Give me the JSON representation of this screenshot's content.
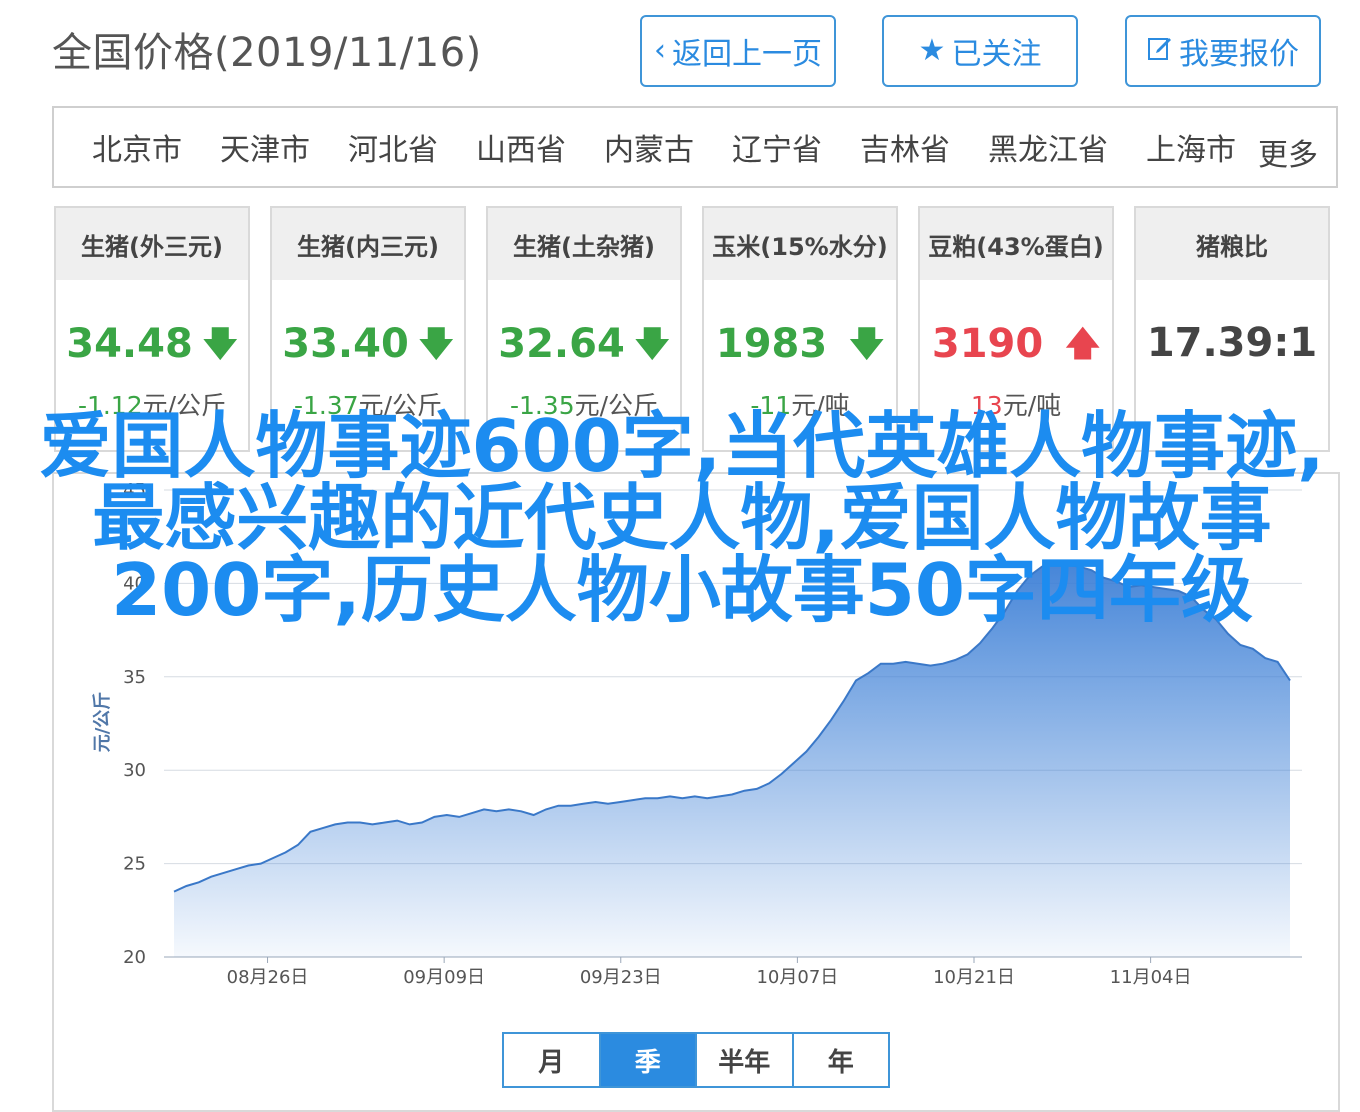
{
  "header": {
    "title": "全国价格(2019/11/16)",
    "back_label": "返回上一页",
    "back_icon": "chevron-left-icon",
    "follow_label": "已关注",
    "follow_icon": "star-icon",
    "quote_label": "我要报价",
    "quote_icon": "edit-icon",
    "accent_color": "#2b8be0"
  },
  "regions": {
    "items": [
      "北京市",
      "天津市",
      "河北省",
      "山西省",
      "内蒙古",
      "辽宁省",
      "吉林省",
      "黑龙江省",
      "上海市"
    ],
    "more_label": "更多"
  },
  "cards": [
    {
      "title": "生猪(外三元)",
      "price": "34.48",
      "direction": "down",
      "change": "-1.12",
      "unit": "元/公斤"
    },
    {
      "title": "生猪(内三元)",
      "price": "33.40",
      "direction": "down",
      "change": "-1.37",
      "unit": "元/公斤"
    },
    {
      "title": "生猪(土杂猪)",
      "price": "32.64",
      "direction": "down",
      "change": "-1.35",
      "unit": "元/公斤"
    },
    {
      "title": "玉米(15%水分)",
      "price": "1983",
      "direction": "down",
      "change": "-11",
      "unit": "元/吨"
    },
    {
      "title": "豆粕(43%蛋白)",
      "price": "3190",
      "direction": "up",
      "change": "13",
      "unit": "元/吨"
    },
    {
      "title": "猪粮比",
      "price": "17.39:1",
      "direction": "none",
      "change": "",
      "unit": ""
    }
  ],
  "overlay_text": "爱国人物事迹600字,当代英雄人物事迹,最感兴趣的近代史人物,爱国人物故事200字,历史人物小故事50字四年级",
  "chart_data": {
    "type": "area",
    "ylabel": "元/公斤",
    "ylim": [
      20,
      45
    ],
    "yticks": [
      20,
      25,
      30,
      35,
      40,
      45
    ],
    "xticks": [
      "08月26日",
      "09月09日",
      "09月23日",
      "10月07日",
      "10月21日",
      "11月04日"
    ],
    "x_start": "2019-08-17",
    "x_end": "2019-11-16",
    "series": [
      {
        "values": [
          23.5,
          23.8,
          24.0,
          24.3,
          24.5,
          24.7,
          24.9,
          25.0,
          25.3,
          25.6,
          26.0,
          26.7,
          26.9,
          27.1,
          27.2,
          27.2,
          27.1,
          27.2,
          27.3,
          27.1,
          27.2,
          27.5,
          27.6,
          27.5,
          27.7,
          27.9,
          27.8,
          27.9,
          27.8,
          27.6,
          27.9,
          28.1,
          28.1,
          28.2,
          28.3,
          28.2,
          28.3,
          28.4,
          28.5,
          28.5,
          28.6,
          28.5,
          28.6,
          28.5,
          28.6,
          28.7,
          28.9,
          29.0,
          29.3,
          29.8,
          30.4,
          31.0,
          31.8,
          32.7,
          33.7,
          34.8,
          35.2,
          35.7,
          35.7,
          35.8,
          35.7,
          35.6,
          35.7,
          35.9,
          36.2,
          36.8,
          37.6,
          38.5,
          39.6,
          40.4,
          40.9,
          41.1,
          41.0,
          40.9,
          40.7,
          40.3,
          40.1,
          39.8,
          39.9,
          39.8,
          39.7,
          39.6,
          39.3,
          38.6,
          38.1,
          37.3,
          36.7,
          36.5,
          36.0,
          35.8,
          34.8
        ]
      }
    ],
    "grid": true,
    "fill_color": "#4a90e2"
  },
  "range_tabs": {
    "items": [
      "月",
      "季",
      "半年",
      "年"
    ],
    "active_index": 1
  }
}
